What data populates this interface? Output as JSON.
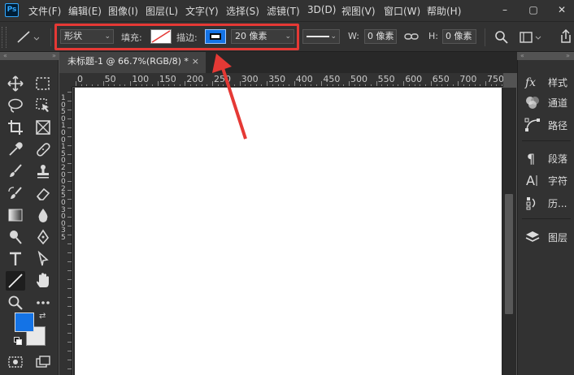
{
  "app": {
    "logo_text": "Ps"
  },
  "menu": {
    "items": [
      "文件(F)",
      "编辑(E)",
      "图像(I)",
      "图层(L)",
      "文字(Y)",
      "选择(S)",
      "滤镜(T)",
      "3D(D)",
      "视图(V)",
      "窗口(W)",
      "帮助(H)"
    ],
    "minimize": "–",
    "maximize": "▢",
    "close": "✕"
  },
  "options_bar": {
    "mode_value": "形状",
    "fill_label": "填充:",
    "stroke_label": "描边:",
    "stroke_width_value": "20 像素",
    "w_label": "W:",
    "w_value": "0 像素",
    "h_label": "H:",
    "h_value": "0 像素",
    "colors": {
      "highlight": "#e53935",
      "accent": "#1473e6"
    }
  },
  "document": {
    "tab_title": "未标题-1 @ 66.7%(RGB/8) *",
    "close": "×"
  },
  "ruler": {
    "h_labels": [
      "0",
      "50",
      "100",
      "150",
      "200",
      "250",
      "300",
      "350",
      "400",
      "450",
      "500",
      "550",
      "600",
      "650",
      "700",
      "750"
    ],
    "v_labels": [
      "1",
      "0",
      "5",
      "0",
      "1",
      "0",
      "0",
      "1",
      "5",
      "0",
      "2",
      "0",
      "0",
      "2",
      "5",
      "0",
      "3",
      "0",
      "0",
      "3",
      "5"
    ]
  },
  "toolbar": {
    "foreground_color": "#1473e6",
    "background_color": "#e8e8e8",
    "selected_tool": "line-tool"
  },
  "right_panel": {
    "items": [
      {
        "label": "样式",
        "icon": "fx-icon"
      },
      {
        "label": "通道",
        "icon": "channels-icon"
      },
      {
        "label": "路径",
        "icon": "paths-icon"
      },
      {
        "label": "段落",
        "icon": "paragraph-icon"
      },
      {
        "label": "字符",
        "icon": "character-icon"
      },
      {
        "label": "历...",
        "icon": "history-icon"
      },
      {
        "label": "图层",
        "icon": "layers-icon"
      }
    ]
  }
}
